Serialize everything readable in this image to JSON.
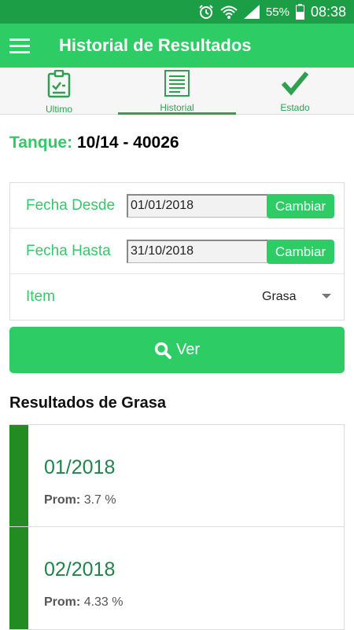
{
  "status": {
    "battery": "55%",
    "time": "08:38"
  },
  "appbar": {
    "title": "Historial de Resultados"
  },
  "tabs": [
    {
      "label": "Ultimo",
      "icon": "clipboard-icon"
    },
    {
      "label": "Historial",
      "icon": "document-list-icon"
    },
    {
      "label": "Estado",
      "icon": "checkmark-icon"
    }
  ],
  "tank": {
    "label": "Tanque:",
    "value": "10/14 - 40026"
  },
  "form": {
    "desde_label": "Fecha Desde",
    "desde_value": "01/01/2018",
    "hasta_label": "Fecha Hasta",
    "hasta_value": "31/10/2018",
    "change_label": "Cambiar",
    "item_label": "Item",
    "item_value": "Grasa"
  },
  "ver_label": "Ver",
  "results_title": "Resultados de Grasa",
  "results": [
    {
      "date": "01/2018",
      "avg_label": "Prom:",
      "avg_value": "3.7 %"
    },
    {
      "date": "02/2018",
      "avg_label": "Prom:",
      "avg_value": "4.33 %"
    }
  ],
  "colors": {
    "primary": "#2ecc65",
    "status_bar": "#1c9e47",
    "accent_dark": "#228b22",
    "label_green": "#34c86b"
  }
}
